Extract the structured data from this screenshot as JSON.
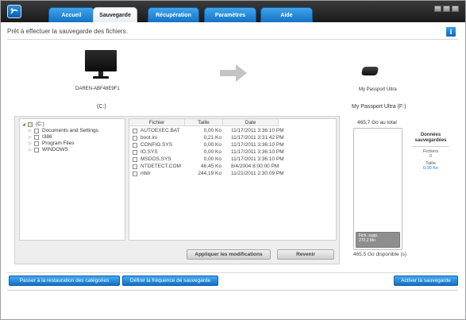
{
  "tabs": [
    {
      "label": "Accueil",
      "active": false
    },
    {
      "label": "Sauvegarde",
      "active": true
    },
    {
      "label": "Récupération",
      "active": false
    },
    {
      "label": "Paramètres",
      "active": false
    },
    {
      "label": "Aide",
      "active": false
    }
  ],
  "status": "Prêt à effectuer la sauvegarde des fichiers.",
  "info_icon": "i",
  "source": {
    "computer_name": "DAREN-ABF48E9F1",
    "drive_label": "(C:)",
    "tree": {
      "root": "(C:)",
      "items": [
        "Documents and Settings",
        "I386",
        "Program Files",
        "WINDOWS"
      ]
    },
    "files_header": {
      "name": "Fichier",
      "size": "Taille",
      "date": "Date"
    },
    "files": [
      {
        "name": "AUTOEXEC.BAT",
        "size": "0,00 Ko",
        "date": "11/17/2011 3:36:10 PM"
      },
      {
        "name": "boot.ini",
        "size": "0,21 Ko",
        "date": "11/17/2011 3:31:42 PM"
      },
      {
        "name": "CONFIG.SYS",
        "size": "0,00 Ko",
        "date": "11/17/2011 3:36:10 PM"
      },
      {
        "name": "IO.SYS",
        "size": "0,00 Ko",
        "date": "11/17/2011 3:36:10 PM"
      },
      {
        "name": "MSDOS.SYS",
        "size": "0,00 Ko",
        "date": "11/17/2011 3:36:10 PM"
      },
      {
        "name": "NTDETECT.COM",
        "size": "46,45 Ko",
        "date": "8/4/2004 8:00:00 PM"
      },
      {
        "name": "ntldr",
        "size": "244,19 Ko",
        "date": "11/21/2011 2:30:09 PM"
      }
    ],
    "apply_label": "Appliquer les modifications",
    "revert_label": "Revenir"
  },
  "destination": {
    "device_name": "My Passport Ultra",
    "drive_label": "My Passport Ultra (F:)",
    "total": "465,7 Go au total",
    "used_label": "Fich. supp.",
    "used_size": "270,2 Mo",
    "free": "465,5 Go disponible (s)",
    "used_fraction": 0.0006
  },
  "saved": {
    "title": "Données sauvegardées",
    "files_label": "Fichiers",
    "files_value": "0",
    "size_label": "Taille",
    "size_value": "0,00 Ko"
  },
  "actions": {
    "restore_categories": "Passer à la restauration des catégories",
    "set_frequency": "Définir la fréquence de sauvegarde",
    "activate": "Activer la sauvegarde"
  },
  "colors": {
    "accent": "#1a7fd6",
    "tab_active": "#ffffff",
    "titlebar": "#2a2a2a"
  }
}
